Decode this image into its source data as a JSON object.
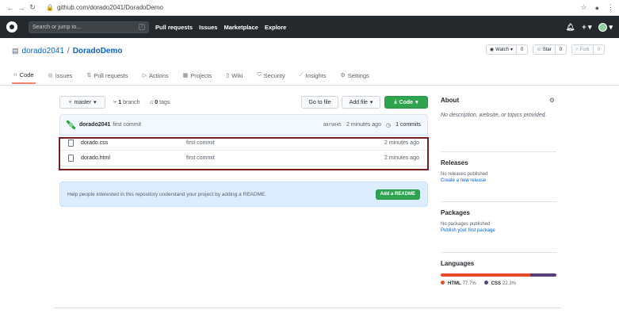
{
  "browser": {
    "url": "github.com/dorado2041/DoradoDemo"
  },
  "header": {
    "search_placeholder": "Search or jump to...",
    "search_key": "/",
    "nav": [
      "Pull requests",
      "Issues",
      "Marketplace",
      "Explore"
    ]
  },
  "repo": {
    "owner": "dorado2041",
    "separator": "/",
    "name": "DoradoDemo",
    "watch": {
      "label": "Watch",
      "count": "0"
    },
    "star": {
      "label": "Star",
      "count": "0"
    },
    "fork": {
      "label": "Fork",
      "count": "0"
    }
  },
  "tabs": [
    {
      "label": "Code",
      "icon": "code-icon"
    },
    {
      "label": "Issues",
      "icon": "issue-icon"
    },
    {
      "label": "Pull requests",
      "icon": "pull-request-icon"
    },
    {
      "label": "Actions",
      "icon": "play-icon"
    },
    {
      "label": "Projects",
      "icon": "project-icon"
    },
    {
      "label": "Wiki",
      "icon": "book-icon"
    },
    {
      "label": "Security",
      "icon": "shield-icon"
    },
    {
      "label": "Insights",
      "icon": "graph-icon"
    },
    {
      "label": "Settings",
      "icon": "gear-icon"
    }
  ],
  "toolbar": {
    "branch": "master",
    "branches_count": "1",
    "branches_label": "branch",
    "tags_count": "0",
    "tags_label": "tags",
    "goto_file": "Go to file",
    "add_file": "Add file",
    "code": "Code"
  },
  "commit": {
    "author": "dorado2041",
    "message": "first commit",
    "sha": "88f9045",
    "age": "2 minutes ago",
    "commits": "1 commits"
  },
  "files": [
    {
      "name": "dorado.css",
      "message": "first commit",
      "age": "2 minutes ago"
    },
    {
      "name": "dorado.html",
      "message": "first commit",
      "age": "2 minutes ago"
    }
  ],
  "readme": {
    "text": "Help people interested in this repository understand your project by adding a README.",
    "button": "Add a README"
  },
  "sidebar": {
    "about_title": "About",
    "about_text": "No description, website, or topics provided.",
    "releases_title": "Releases",
    "releases_text": "No releases published",
    "releases_link": "Create a new release",
    "packages_title": "Packages",
    "packages_text": "No packages published",
    "packages_link": "Publish your first package",
    "languages_title": "Languages",
    "languages": [
      {
        "name": "HTML",
        "percent": "77.7%",
        "value": 77.7,
        "color": "#e34c26"
      },
      {
        "name": "CSS",
        "percent": "22.3%",
        "value": 22.3,
        "color": "#563d7c"
      }
    ]
  },
  "colors": {
    "highlight_border": "#7a1d1d",
    "active_tab": "#f9826c",
    "green_button": "#2ea44f"
  }
}
